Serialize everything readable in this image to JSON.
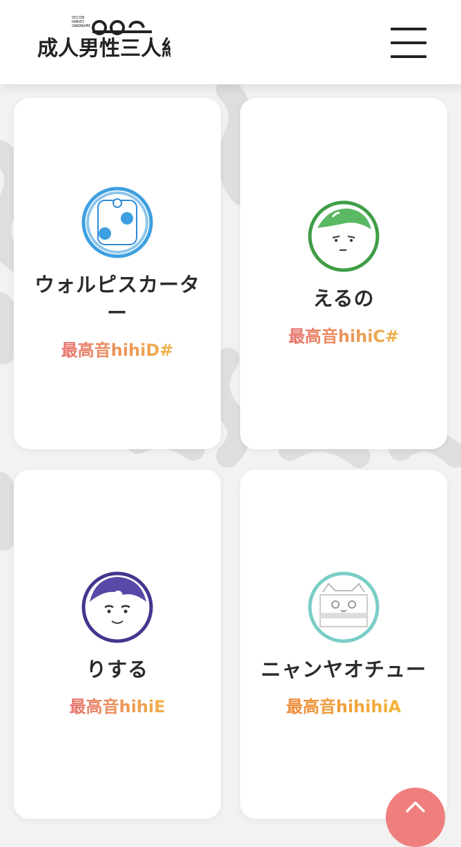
{
  "header": {
    "logo_text": "成人男性三人組",
    "logo_small_text": "SEIJIN DANSEI SANINGUMI",
    "menu_icon": "hamburger-menu-icon"
  },
  "members": [
    {
      "name": "ウォルピスカーター",
      "note": "最高音hihiD#",
      "color": "#4aa3e0",
      "icon": "walpiscarter-avatar-icon"
    },
    {
      "name": "えるの",
      "note": "最高音hihiC#",
      "color": "#44a84a",
      "icon": "eruno-avatar-icon"
    },
    {
      "name": "りする",
      "note": "最高音hihiE",
      "color": "#4b3a96",
      "icon": "risuru-avatar-icon"
    },
    {
      "name": "ニャンヤオチュー",
      "note": "最高音hihihiA",
      "color": "#7ccfc9",
      "icon": "nyanyaochu-avatar-icon"
    }
  ],
  "back_to_top": {
    "icon": "chevron-up-icon",
    "color": "#ef7f7c"
  }
}
